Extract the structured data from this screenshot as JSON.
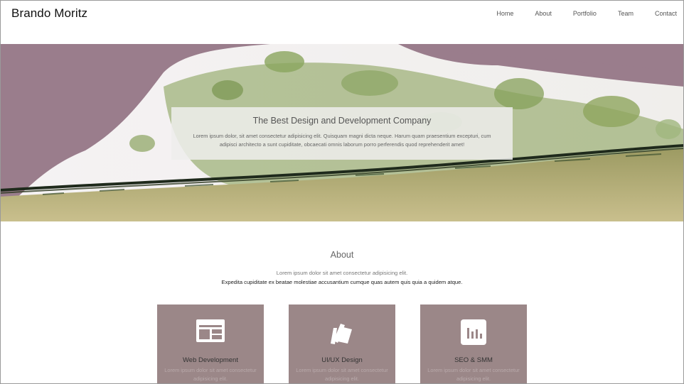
{
  "header": {
    "brand": "Brando Moritz",
    "nav": [
      "Home",
      "About",
      "Portfolio",
      "Team",
      "Contact"
    ]
  },
  "hero": {
    "title": "The Best Design and Development Company",
    "text": "Lorem ipsum dolor, sit amet consectetur adipisicing elit. Quisquam magni dicta neque. Harum quam praesentium excepturi, cum adipisci architecto a sunt cupiditate, obcaecati omnis laborum porro perferendis quod reprehenderit amet!"
  },
  "about": {
    "title": "About",
    "line1": "Lorem ipsum dolor sit amet consectetur adipisicing elit.",
    "line2": "Expedita cupiditate ex beatae molestiae accusantium cumque quas autem quis quia a quidem atque."
  },
  "services": [
    {
      "title": "Web Development",
      "text": "Lorem ipsum dolor sit amet consectetur adipisicing elit.",
      "icon": "web-layout-icon"
    },
    {
      "title": "UI/UX Design",
      "text": "Lorem ipsum dolor sit amet consectetur adipisicing elit.",
      "icon": "swatches-icon"
    },
    {
      "title": "SEO & SMM",
      "text": "Lorem ipsum dolor sit amet consectetur adipisicing elit.",
      "icon": "bar-chart-icon"
    }
  ],
  "colors": {
    "card_bg": "#9b8788",
    "hero_mauve": "#9a7d8c",
    "hero_green": "#8ea06a",
    "hero_sand": "#b7b07c"
  }
}
